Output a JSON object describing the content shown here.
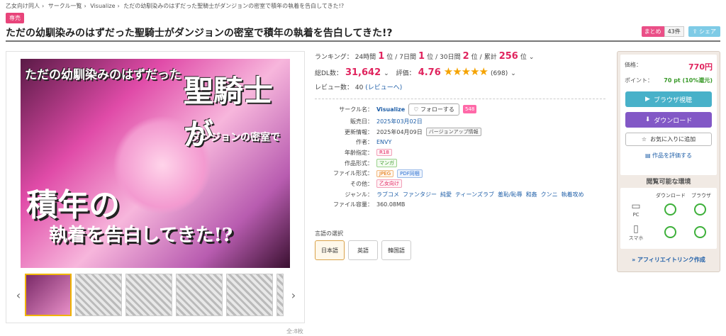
{
  "breadcrumb": [
    "乙女向け同人",
    "サークル一覧",
    "Visualize",
    "ただの幼馴染みのはずだった聖騎士がダンジョンの密室で積年の執着を告白してきた!?"
  ],
  "exclusive_badge": "専売",
  "title": "ただの幼馴染みのはずだった聖騎士がダンジョンの密室で積年の執着を告白してきた!?",
  "top_actions": {
    "matome_label": "まとめ",
    "matome_count": "43件",
    "share_label": "シェア"
  },
  "cover": {
    "line1": "ただの幼馴染みのはずだった",
    "line2": "聖騎士が",
    "line3": "ダンジョンの密室で",
    "line4": "積年の",
    "line5": "執着を告白してきた!?"
  },
  "thumbnails": {
    "count_label": "全:8枚",
    "visible": 6
  },
  "ranking": {
    "label": "ランキング：",
    "items": [
      {
        "period": "24時間",
        "rank": "1",
        "suffix": "位"
      },
      {
        "period": "7日間",
        "rank": "1",
        "suffix": "位"
      },
      {
        "period": "30日間",
        "rank": "2",
        "suffix": "位"
      },
      {
        "period": "累計",
        "rank": "256",
        "suffix": "位"
      }
    ]
  },
  "stats": {
    "dl_label": "総DL数：",
    "dl_count": "31,642",
    "rating_label": "評価：",
    "rating": "4.76",
    "stars": "★★★★★",
    "rating_count": "(698)",
    "review_label": "レビュー数：",
    "review_count": "40",
    "review_link": "(レビューへ)"
  },
  "specs": {
    "circle_label": "サークル名：",
    "circle": "Visualize",
    "follow": "フォローする",
    "follow_count": "548",
    "sale_label": "販売日：",
    "sale_date": "2025年03月02日",
    "update_label": "更新情報：",
    "update_date": "2025年04月09日",
    "update_tag": "バージョンアップ情報",
    "author_label": "作者：",
    "author": "ENVY",
    "age_label": "年齢指定：",
    "age": "R18",
    "format_label": "作品形式：",
    "format": "マンガ",
    "filetype_label": "ファイル形式：",
    "filetype1": "JPEG",
    "filetype2": "PDF同梱",
    "other_label": "その他：",
    "other": "乙女向け",
    "genre_label": "ジャンル：",
    "genres": [
      "ラブコメ",
      "ファンタジー",
      "純愛",
      "ティーンズラブ",
      "羞恥/恥辱",
      "和姦",
      "クンニ",
      "執着攻め"
    ],
    "size_label": "ファイル容量：",
    "size": "360.08MB"
  },
  "language": {
    "label": "言語の選択",
    "options": [
      "日本語",
      "英語",
      "韓国語"
    ],
    "selected": "日本語"
  },
  "purchase": {
    "price_label": "価格：",
    "price": "770円",
    "point_label": "ポイント：",
    "points": "70 pt (10%還元)",
    "browser_btn": "ブラウザ視聴",
    "download_btn": "ダウンロード",
    "favorite_btn": "お気に入りに追加",
    "evaluate_link": "作品を評価する"
  },
  "environment": {
    "title": "閲覧可能な環境",
    "col_download": "ダウンロード",
    "col_browser": "ブラウザ",
    "pc": "PC",
    "phone": "スマホ"
  },
  "affiliate": "» アフィリエイトリンク作成",
  "colors": {
    "accent": "#e0245e",
    "browser": "#48b1c9",
    "download": "#8258c6",
    "ok": "#3db03a"
  }
}
